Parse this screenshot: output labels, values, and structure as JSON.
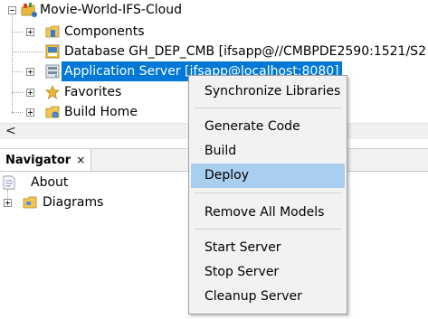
{
  "tree": {
    "root": {
      "label": "Movie-World-IFS-Cloud"
    },
    "items": [
      {
        "label": "Components"
      },
      {
        "label": "Database GH_DEP_CMB [ifsapp@//CMBPDE2590:1521/S2"
      },
      {
        "label": "Application Server [ifsapp@localhost:8080]"
      },
      {
        "label": "Favorites"
      },
      {
        "label": "Build Home"
      }
    ]
  },
  "scrollbar": {
    "left_arrow": "<"
  },
  "navigator": {
    "tab_label": "Navigator",
    "close_glyph": "×",
    "items": [
      {
        "label": "About"
      },
      {
        "label": "Diagrams"
      }
    ]
  },
  "context_menu": {
    "groups": [
      [
        "Synchronize Libraries"
      ],
      [
        "Generate Code",
        "Build",
        "Deploy"
      ],
      [
        "Remove All Models"
      ],
      [
        "Start Server",
        "Stop Server",
        "Cleanup Server"
      ]
    ],
    "highlighted": "Deploy"
  },
  "colors": {
    "selection": "#0078d7",
    "menu_highlight": "#a9cff0",
    "menu_background": "#f2f2f2"
  },
  "icons": {
    "root": "project-folder-icon",
    "components": "components-icon",
    "database": "database-icon",
    "app_server": "server-icon",
    "favorites": "star-icon",
    "build_home": "build-folder-icon",
    "about": "document-icon",
    "diagrams": "folder-icon"
  }
}
